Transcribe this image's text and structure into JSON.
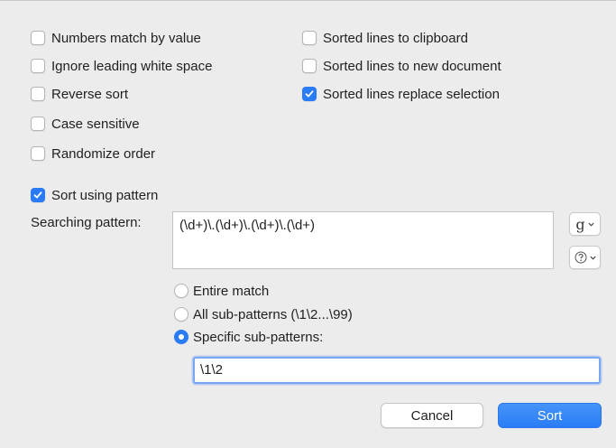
{
  "colors": {
    "accent": "#2a7cf6",
    "background": "#ececec"
  },
  "options_left": [
    {
      "label": "Numbers match by value",
      "checked": false
    },
    {
      "label": "Ignore leading white space",
      "checked": false
    },
    {
      "label": "Reverse sort",
      "checked": false
    },
    {
      "label": "Case sensitive",
      "checked": false
    },
    {
      "label": "Randomize order",
      "checked": false
    }
  ],
  "options_right": [
    {
      "label": "Sorted lines to clipboard",
      "checked": false
    },
    {
      "label": "Sorted lines to new document",
      "checked": false
    },
    {
      "label": "Sorted lines replace selection",
      "checked": true
    }
  ],
  "pattern": {
    "use_label": "Sort using pattern",
    "use_checked": true,
    "search_label": "Searching pattern:",
    "value": "(\\d+)\\.(\\d+)\\.(\\d+)\\.(\\d+)",
    "grep_button": "g",
    "grep_icon": "chevron-down-icon",
    "help_icon": "help-icon"
  },
  "match_mode": {
    "options": [
      "Entire match",
      "All sub-patterns (\\1\\2...\\99)",
      "Specific sub-patterns:"
    ],
    "selected": "Specific sub-patterns:"
  },
  "subpatterns_value": "\\1\\2",
  "buttons": {
    "cancel": "Cancel",
    "sort": "Sort"
  }
}
